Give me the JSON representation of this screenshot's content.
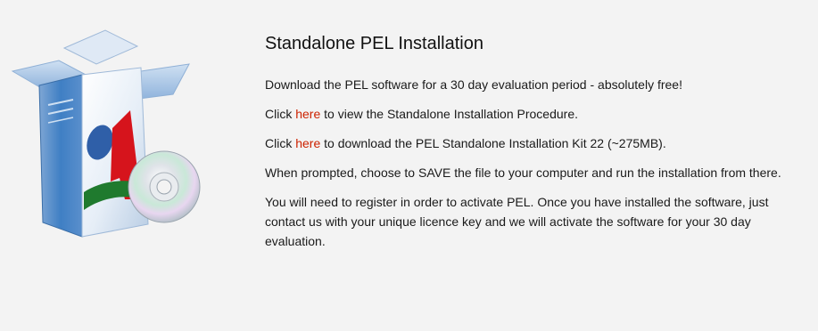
{
  "heading": "Standalone PEL Installation",
  "intro": "Download the PEL software for a 30 day evaluation period - absolutely free!",
  "procedure": {
    "before": "Click ",
    "link_text": "here",
    "after": " to view the Standalone Installation Procedure."
  },
  "download": {
    "before": "Click ",
    "link_text": "here",
    "after": " to download the PEL Standalone Installation Kit 22 (~275MB)."
  },
  "save_note": "When prompted, choose to SAVE the file to your computer and run the installation from there.",
  "register_note": "You will need to register in order to activate PEL. Once you have installed the software, just contact us with your unique licence key and we will activate the software for your 30 day evaluation.",
  "colors": {
    "background": "#f3f3f3",
    "link": "#cc2200",
    "box_blue": "#2f6fb8",
    "logo_red": "#d6141c",
    "logo_green": "#1f7a2e"
  },
  "icons": {
    "product_box": "software-box-icon",
    "disc": "cd-disc-icon"
  }
}
